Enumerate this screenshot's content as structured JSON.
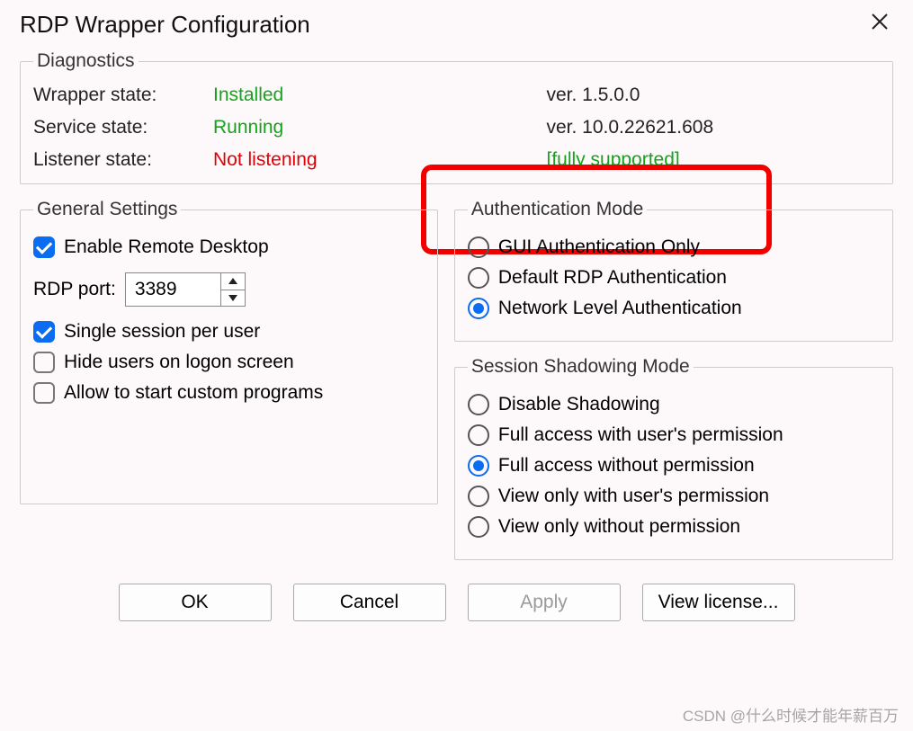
{
  "title": "RDP Wrapper Configuration",
  "diagnostics": {
    "legend": "Diagnostics",
    "rows": {
      "wrapper_label": "Wrapper state:",
      "wrapper_value": "Installed",
      "wrapper_ver": "ver. 1.5.0.0",
      "service_label": "Service state:",
      "service_value": "Running",
      "service_ver": "ver. 10.0.22621.608",
      "listener_label": "Listener state:",
      "listener_value": "Not listening",
      "listener_support": "[fully supported]"
    }
  },
  "general": {
    "legend": "General Settings",
    "enable_rdp": "Enable Remote Desktop",
    "rdp_port_label": "RDP port:",
    "rdp_port_value": "3389",
    "single_session": "Single session per user",
    "hide_users": "Hide users on logon screen",
    "allow_custom": "Allow to start custom programs"
  },
  "auth": {
    "legend": "Authentication Mode",
    "opt_gui": "GUI Authentication Only",
    "opt_default": "Default RDP Authentication",
    "opt_nla": "Network Level Authentication"
  },
  "shadow": {
    "legend": "Session Shadowing Mode",
    "opt_disable": "Disable Shadowing",
    "opt_full_perm": "Full access with user's permission",
    "opt_full_noperm": "Full access without permission",
    "opt_view_perm": "View only with user's permission",
    "opt_view_noperm": "View only without permission"
  },
  "buttons": {
    "ok": "OK",
    "cancel": "Cancel",
    "apply": "Apply",
    "license": "View license..."
  },
  "watermark": "CSDN @什么时候才能年薪百万"
}
